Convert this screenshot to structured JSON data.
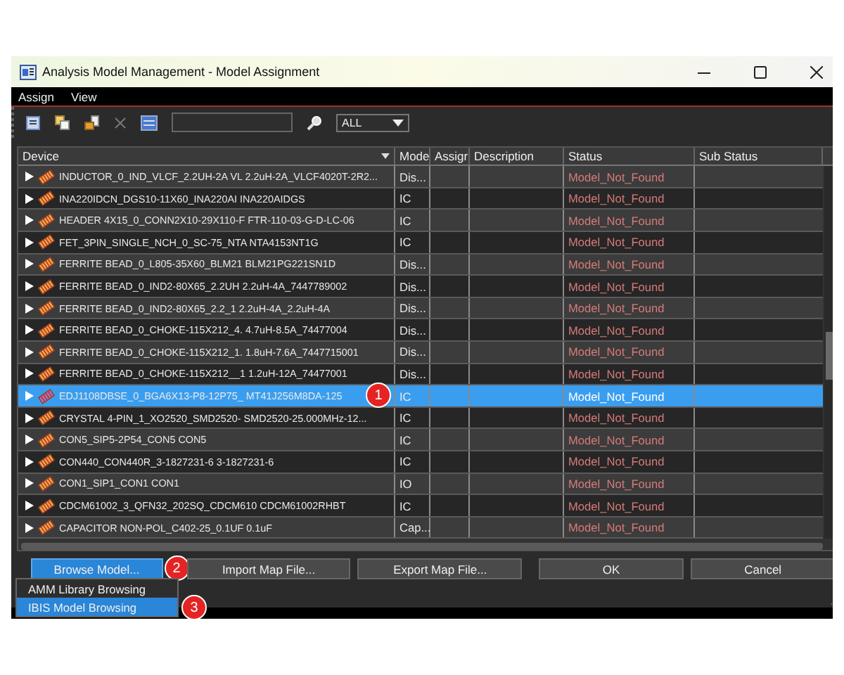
{
  "window": {
    "title": "Analysis Model Management - Model Assignment"
  },
  "menu": [
    "Assign",
    "View"
  ],
  "toolbar": {
    "filter": {
      "value": "ALL"
    }
  },
  "table": {
    "columns": [
      "Device",
      "Mode",
      "Assigr",
      "Description",
      "Status",
      "Sub Status"
    ],
    "rows": [
      {
        "device": "INDUCTOR_0_IND_VLCF_2.2UH-2A VL 2.2uH-2A_VLCF4020T-2R2...",
        "model": "Dis...",
        "status": "Model_Not_Found",
        "selected": false
      },
      {
        "device": "INA220IDCN_DGS10-11X60_INA220AI INA220AIDGS",
        "model": "IC",
        "status": "Model_Not_Found",
        "selected": false
      },
      {
        "device": "HEADER 4X15_0_CONN2X10-29X110-F FTR-110-03-G-D-LC-06",
        "model": "IC",
        "status": "Model_Not_Found",
        "selected": false
      },
      {
        "device": "FET_3PIN_SINGLE_NCH_0_SC-75_NTA NTA4153NT1G",
        "model": "IC",
        "status": "Model_Not_Found",
        "selected": false
      },
      {
        "device": "FERRITE BEAD_0_L805-35X60_BLM21 BLM21PG221SN1D",
        "model": "Dis...",
        "status": "Model_Not_Found",
        "selected": false
      },
      {
        "device": "FERRITE BEAD_0_IND2-80X65_2.2UH 2.2uH-4A_7447789002",
        "model": "Dis...",
        "status": "Model_Not_Found",
        "selected": false
      },
      {
        "device": "FERRITE BEAD_0_IND2-80X65_2.2_1 2.2uH-4A_2.2uH-4A",
        "model": "Dis...",
        "status": "Model_Not_Found",
        "selected": false
      },
      {
        "device": "FERRITE BEAD_0_CHOKE-115X212_4. 4.7uH-8.5A_74477004",
        "model": "Dis...",
        "status": "Model_Not_Found",
        "selected": false
      },
      {
        "device": "FERRITE BEAD_0_CHOKE-115X212_1. 1.8uH-7.6A_7447715001",
        "model": "Dis...",
        "status": "Model_Not_Found",
        "selected": false
      },
      {
        "device": "FERRITE BEAD_0_CHOKE-115X212__1 1.2uH-12A_74477001",
        "model": "Dis...",
        "status": "Model_Not_Found",
        "selected": false
      },
      {
        "device": "EDJ1108DBSE_0_BGA6X13-P8-12P75_ MT41J256M8DA-125",
        "model": "IC",
        "status": "Model_Not_Found",
        "selected": true,
        "badge": "1"
      },
      {
        "device": "CRYSTAL 4-PIN_1_XO2520_SMD2520- SMD2520-25.000MHz-12...",
        "model": "IC",
        "status": "Model_Not_Found",
        "selected": false
      },
      {
        "device": "CON5_SIP5-2P54_CON5 CON5",
        "model": "IC",
        "status": "Model_Not_Found",
        "selected": false
      },
      {
        "device": "CON440_CON440R_3-1827231-6 3-1827231-6",
        "model": "IC",
        "status": "Model_Not_Found",
        "selected": false
      },
      {
        "device": "CON1_SIP1_CON1 CON1",
        "model": "IO",
        "status": "Model_Not_Found",
        "selected": false
      },
      {
        "device": "CDCM61002_3_QFN32_202SQ_CDCM610 CDCM61002RHBT",
        "model": "IC",
        "status": "Model_Not_Found",
        "selected": false
      },
      {
        "device": "CAPACITOR NON-POL_C402-25_0.1UF 0.1uF",
        "model": "Cap...",
        "status": "Model_Not_Found",
        "selected": false
      }
    ]
  },
  "buttons": [
    {
      "label": "Browse Model...",
      "selected": true,
      "badge": "2"
    },
    {
      "label": "Import Map File...",
      "selected": false
    },
    {
      "label": "Export Map File...",
      "selected": false
    },
    {
      "label": "OK",
      "selected": false
    },
    {
      "label": "Cancel",
      "selected": false
    }
  ],
  "browse_menu": [
    {
      "label": "AMM Library Browsing",
      "selected": false
    },
    {
      "label": "IBIS Model Browsing",
      "selected": true,
      "badge": "3"
    }
  ]
}
